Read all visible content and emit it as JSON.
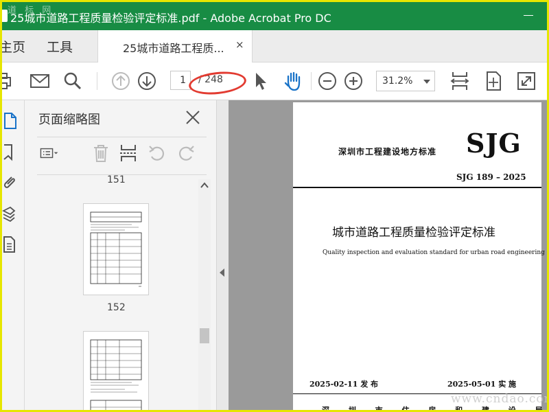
{
  "window": {
    "title": "25城市道路工程质量检验评定标准.pdf - Adobe Acrobat Pro DC",
    "watermark_top": "道 标 网"
  },
  "nav": {
    "home": "主页",
    "tools": "工具"
  },
  "tab": {
    "label": "25城市道路工程质...",
    "close": "×"
  },
  "toolbar": {
    "current_page": "1",
    "total_pages": "/ 248",
    "zoom": "31.2%",
    "icons": [
      "print-icon",
      "email-icon",
      "search-icon",
      "page-up-icon",
      "page-down-icon",
      "select-cursor-icon",
      "hand-tool-icon",
      "zoom-out-icon",
      "zoom-in-icon",
      "fit-page-icon",
      "rotate-view-icon",
      "full-screen-icon"
    ]
  },
  "colors": {
    "title_bar": "#188c44",
    "accent_blue": "#1a73c8",
    "annotation": "#e23b31",
    "frame": "#e6e600"
  },
  "sidebar": {
    "title": "页面缩略图",
    "thumbnails": [
      {
        "label": "151"
      },
      {
        "label": "152"
      }
    ]
  },
  "document": {
    "issuer": "深圳市工程建设地方标准",
    "logo": "SJG",
    "standard_number": "SJG 189 – 2025",
    "title_cn": "城市道路工程质量检验评定标准",
    "title_en": "Quality inspection and evaluation standard for urban road engineering",
    "issue_date": "2025-02-11 发 布",
    "implement_date": "2025-05-01 实 施",
    "authority": "深 圳 市 住 房 和 建 设 局"
  },
  "watermark_bottom": "www.cndao.com"
}
